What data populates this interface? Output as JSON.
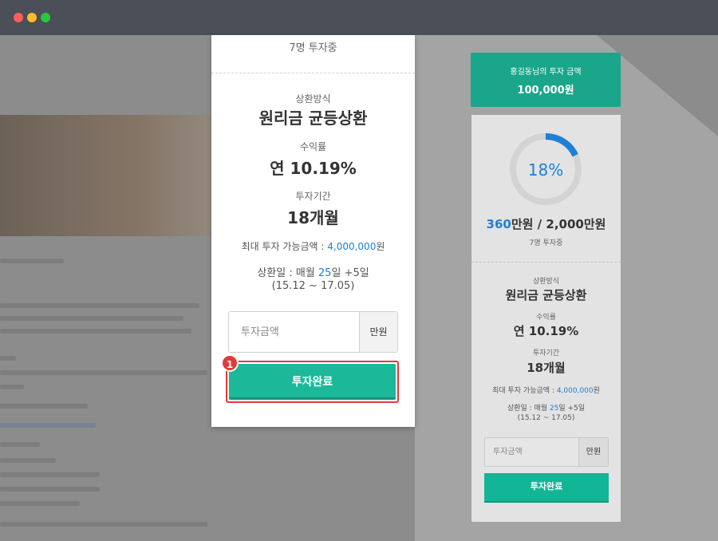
{
  "window": {
    "controls": [
      "close",
      "minimize",
      "maximize"
    ]
  },
  "modal": {
    "investors": "7명 투자중",
    "repayment_label": "상환방식",
    "repayment_value": "원리금 균등상환",
    "yield_label": "수익률",
    "yield_value": "연 10.19%",
    "period_label": "투자기간",
    "period_value": "18개월",
    "max_invest_prefix": "최대 투자 가능금액 : ",
    "max_invest_amount": "4,000,000",
    "max_invest_suffix": "원",
    "repay_day_prefix": "상환일 : 매월 ",
    "repay_day_number": "25",
    "repay_day_suffix": "일 +5일",
    "repay_range": "(15.12 ~ 17.05)",
    "amount_placeholder": "투자금액",
    "amount_unit": "만원",
    "submit_label": "투자완료",
    "step_badge": "1"
  },
  "sidebar": {
    "header_title": "홍길동님의 투자 금액",
    "header_amount": "100,000원",
    "progress_percent_label": "18%",
    "progress_fraction": 0.18,
    "raised_amount": "360",
    "raised_mid": "만원 / 2,000만원",
    "investors": "7명 투자중",
    "repayment_label": "상환방식",
    "repayment_value": "원리금 균등상환",
    "yield_label": "수익률",
    "yield_value": "연 10.19%",
    "period_label": "투자기간",
    "period_value": "18개월",
    "max_invest_prefix": "최대 투자 가능금액 : ",
    "max_invest_amount": "4,000,000",
    "max_invest_suffix": "원",
    "repay_day_prefix": "상환일 : 매월 ",
    "repay_day_number": "25",
    "repay_day_suffix": "일 +5일",
    "repay_range": "(15.12 ~ 17.05)",
    "amount_placeholder": "투자금액",
    "amount_unit": "만원",
    "submit_label": "투자완료"
  },
  "colors": {
    "accent_green": "#1bb89a",
    "header_green": "#1aa68a",
    "highlight_red": "#e13b36",
    "link_blue": "#1e7fd6",
    "progress_blue": "#1e7fd6"
  }
}
